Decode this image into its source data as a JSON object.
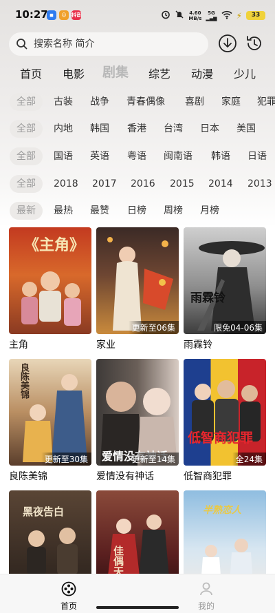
{
  "status_bar": {
    "time": "10:27",
    "net_speed_value": "4.60",
    "net_speed_unit": "MB/s",
    "network": "5G",
    "battery": "33",
    "app_badge_3": "抖音"
  },
  "search": {
    "placeholder": "搜索名称 简介"
  },
  "header_icons": {
    "download": "download-icon",
    "history": "history-icon"
  },
  "main_tabs": [
    {
      "label": "首页",
      "active": false
    },
    {
      "label": "电影",
      "active": false
    },
    {
      "label": "剧集",
      "active": true
    },
    {
      "label": "综艺",
      "active": false
    },
    {
      "label": "动漫",
      "active": false
    },
    {
      "label": "少儿",
      "active": false
    }
  ],
  "filters": {
    "genre": [
      "全部",
      "古装",
      "战争",
      "青春偶像",
      "喜剧",
      "家庭",
      "犯罪"
    ],
    "region": [
      "全部",
      "内地",
      "韩国",
      "香港",
      "台湾",
      "日本",
      "美国"
    ],
    "language": [
      "全部",
      "国语",
      "英语",
      "粤语",
      "闽南语",
      "韩语",
      "日语"
    ],
    "year": [
      "全部",
      "2018",
      "2017",
      "2016",
      "2015",
      "2014",
      "2013"
    ],
    "sort": [
      "最新",
      "最热",
      "最赞",
      "日榜",
      "周榜",
      "月榜"
    ]
  },
  "shows": [
    {
      "title": "主角",
      "tag": "",
      "poster_text": "《主角》",
      "colors": [
        "#b8371f",
        "#e0752b"
      ]
    },
    {
      "title": "家业",
      "tag": "更新至06集",
      "poster_text": "",
      "colors": [
        "#5c3a2a",
        "#c9842f"
      ]
    },
    {
      "title": "雨霖铃",
      "tag": "限免04-06集",
      "poster_text": "雨霖铃",
      "colors": [
        "#3a3a3a",
        "#a9a9a9"
      ]
    },
    {
      "title": "良陈美锦",
      "tag": "更新至30集",
      "poster_text": "良陈美锦",
      "colors": [
        "#7b5a3e",
        "#d7b98d"
      ]
    },
    {
      "title": "爱情没有神话",
      "tag": "更新至14集",
      "poster_text": "爱情没有神话",
      "colors": [
        "#4a4440",
        "#cfc3bd"
      ]
    },
    {
      "title": "低智商犯罪",
      "tag": "全24集",
      "poster_text": "低智商犯罪",
      "colors": [
        "#c8232a",
        "#f2c230"
      ]
    },
    {
      "title": "",
      "tag": "",
      "poster_text": "黑夜告白",
      "colors": [
        "#3b2e25",
        "#8a6a4a"
      ]
    },
    {
      "title": "",
      "tag": "",
      "poster_text": "佳偶天成",
      "colors": [
        "#5a1f1f",
        "#b66a5a"
      ]
    },
    {
      "title": "",
      "tag": "",
      "poster_text": "半熟恋人",
      "colors": [
        "#7fb0d8",
        "#f0e8e0"
      ]
    }
  ],
  "bottom_nav": [
    {
      "label": "首页",
      "active": true,
      "icon": "film-reel-icon"
    },
    {
      "label": "我的",
      "active": false,
      "icon": "user-icon"
    }
  ]
}
